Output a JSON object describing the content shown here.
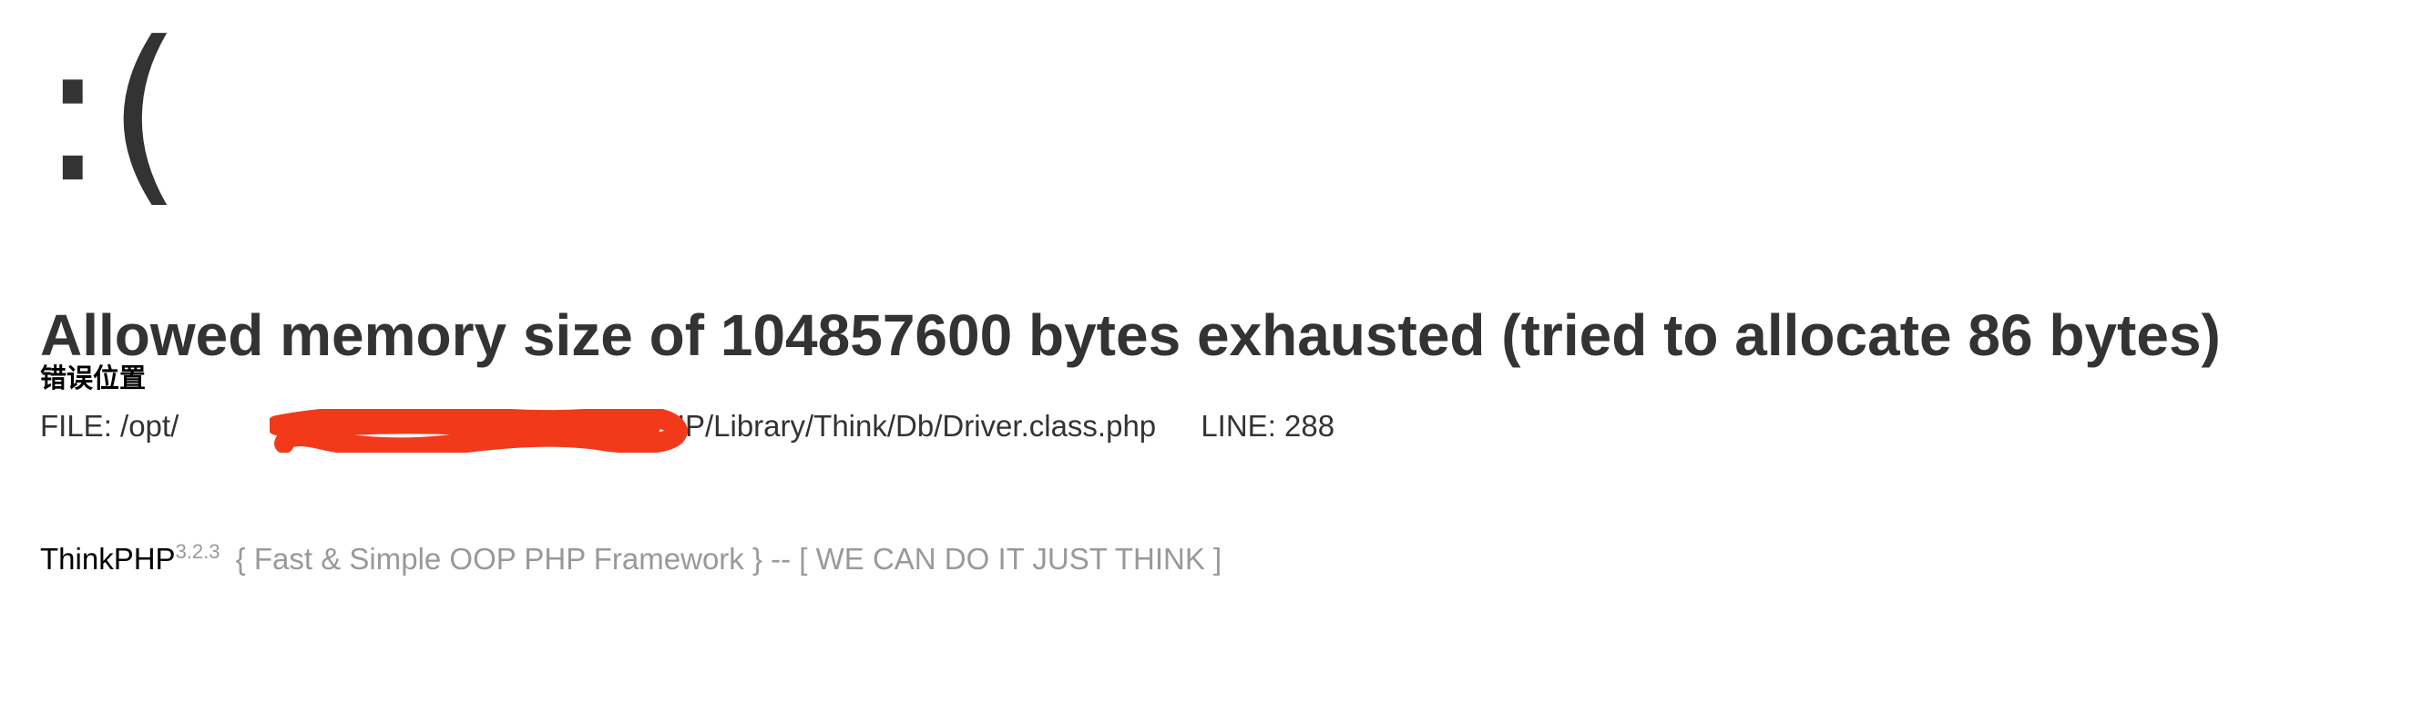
{
  "face": ":(",
  "error": {
    "message": "Allowed memory size of 104857600 bytes exhausted (tried to allocate 86 bytes)",
    "location_title": "错误位置",
    "file_label": "FILE:",
    "file_path": "/opt/",
    "file_path_rest": "/ThinkPHP/Library/Think/Db/Driver.class.php",
    "line_label": "LINE:",
    "line_number": "288"
  },
  "footer": {
    "brand": "ThinkPHP",
    "version": "3.2.3",
    "slogan": "{ Fast & Simple OOP PHP Framework } -- [ WE CAN DO IT JUST THINK ]"
  },
  "colors": {
    "text": "#333333",
    "muted": "#999999",
    "redaction": "#f23a1b"
  }
}
